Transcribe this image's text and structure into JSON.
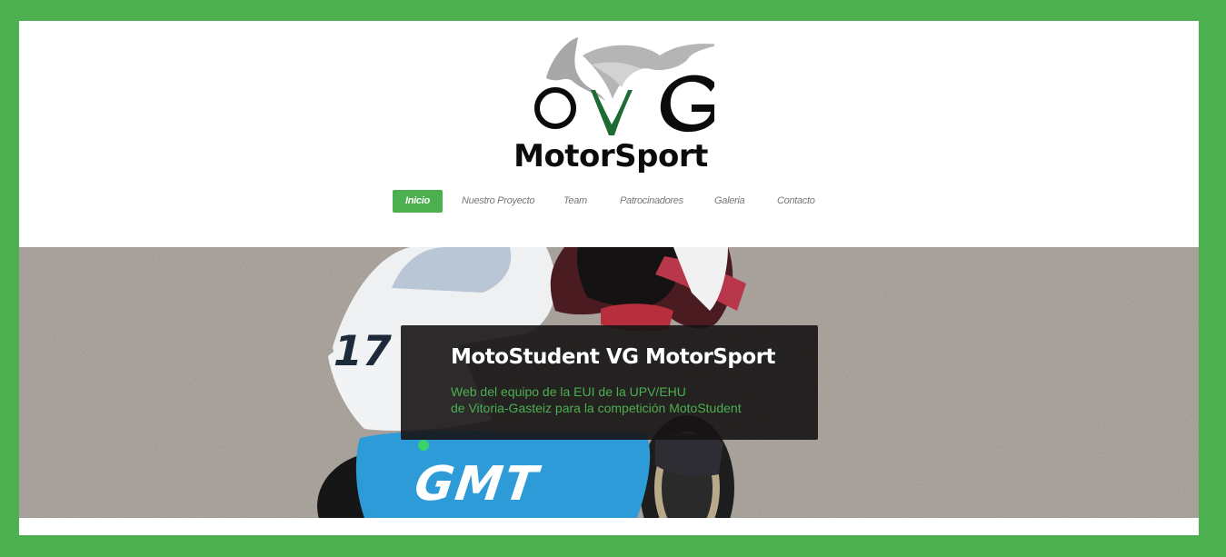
{
  "logo": {
    "letters": "VG",
    "brand_text": "MotorSport"
  },
  "nav": {
    "items": [
      {
        "label": "Inicio",
        "active": true
      },
      {
        "label": "Nuestro Proyecto",
        "active": false
      },
      {
        "label": "Team",
        "active": false
      },
      {
        "label": "Patrocinadores",
        "active": false
      },
      {
        "label": "Galeria",
        "active": false
      },
      {
        "label": "Contacto",
        "active": false
      }
    ]
  },
  "hero": {
    "title": "MotoStudent VG MotorSport",
    "line1": "Web del equipo de la EUI de la UPV/EHU",
    "line2": "de Vitoria-Gasteiz para la competición MotoStudent",
    "bike_number": "17",
    "fairing_text": "GMT"
  },
  "colors": {
    "accent": "#4caf50",
    "frame": "#4caf50",
    "caption_bg": "#161414"
  }
}
